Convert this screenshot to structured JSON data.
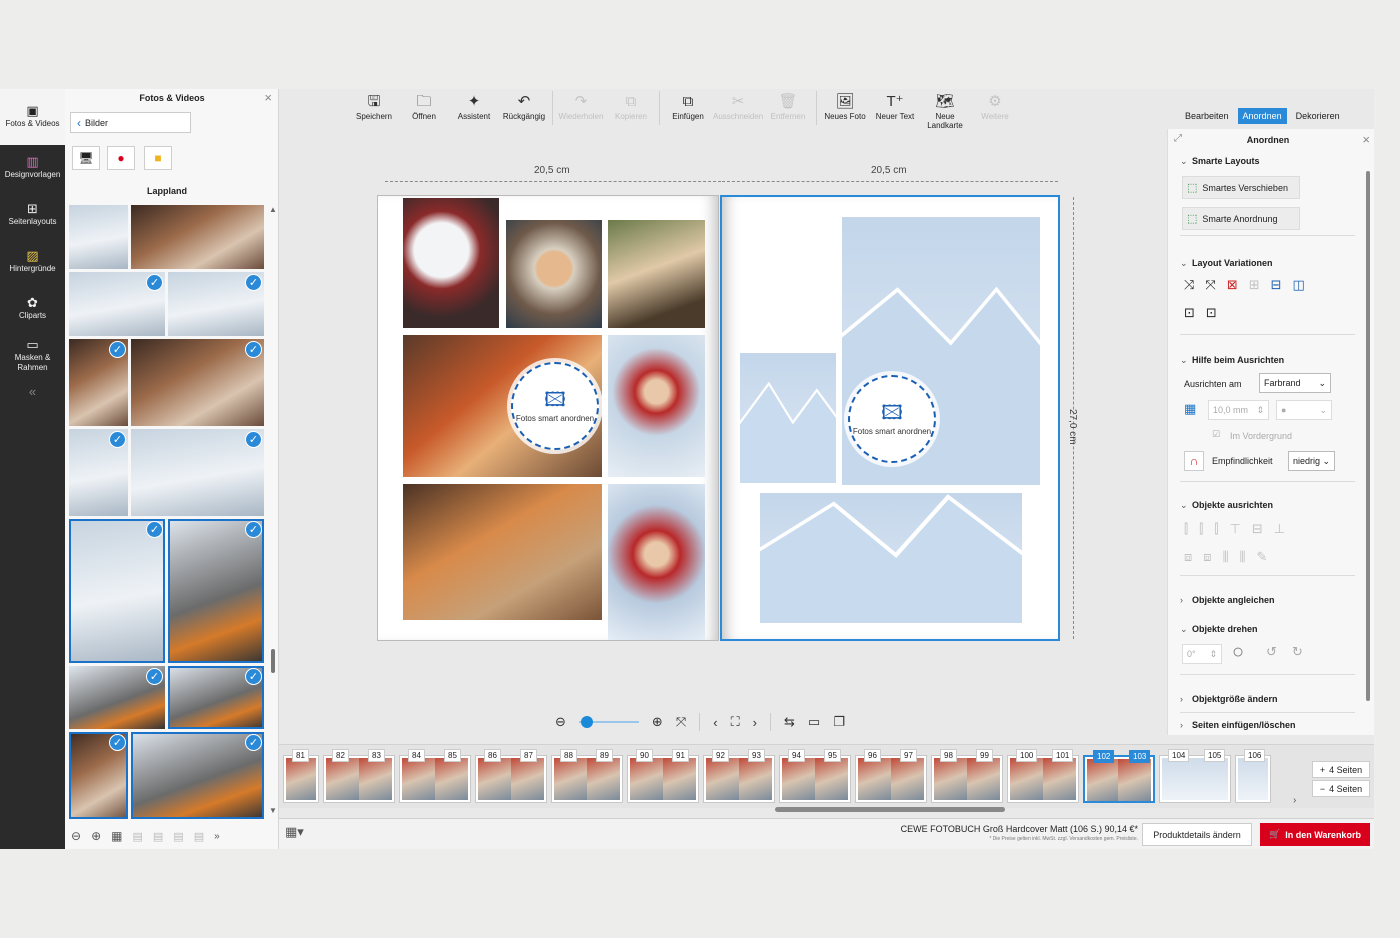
{
  "rail": {
    "items": [
      {
        "label": "Fotos & Videos",
        "icon": "photos-icon"
      },
      {
        "label": "Designvorlagen",
        "icon": "design-icon"
      },
      {
        "label": "Seitenlayouts",
        "icon": "layout-icon"
      },
      {
        "label": "Hintergründe",
        "icon": "background-icon"
      },
      {
        "label": "Cliparts",
        "icon": "clipart-icon"
      },
      {
        "label": "Masken & Rahmen",
        "icon": "mask-icon"
      }
    ],
    "collapse": "«"
  },
  "panel": {
    "title": "Fotos & Videos",
    "close": "×",
    "back_label": "Bilder",
    "album_title": "Lappland"
  },
  "toolbar": [
    {
      "label": "Speichern",
      "icon": "save-icon",
      "glyph": "🖫",
      "enabled": true
    },
    {
      "label": "Öffnen",
      "icon": "folder-icon",
      "glyph": "🗀",
      "enabled": true
    },
    {
      "label": "Assistent",
      "icon": "wand-icon",
      "glyph": "✦",
      "enabled": true
    },
    {
      "label": "Rückgängig",
      "icon": "undo-icon",
      "glyph": "↶",
      "enabled": true
    },
    {
      "label": "Wiederholen",
      "icon": "redo-icon",
      "glyph": "↷",
      "enabled": false
    },
    {
      "label": "Kopieren",
      "icon": "copy-icon",
      "glyph": "⧉",
      "enabled": false
    },
    {
      "label": "Einfügen",
      "icon": "paste-icon",
      "glyph": "⧉",
      "enabled": true
    },
    {
      "label": "Ausschneiden",
      "icon": "scissors-icon",
      "glyph": "✂",
      "enabled": false
    },
    {
      "label": "Entfernen",
      "icon": "trash-icon",
      "glyph": "🗑",
      "enabled": false
    },
    {
      "label": "Neues Foto",
      "icon": "new-photo-icon",
      "glyph": "🖼",
      "enabled": true
    },
    {
      "label": "Neuer Text",
      "icon": "new-text-icon",
      "glyph": "T⁺",
      "enabled": true
    },
    {
      "label": "Neue Landkarte",
      "icon": "map-icon",
      "glyph": "🗺",
      "enabled": true
    },
    {
      "label": "Weitere",
      "icon": "more-icon",
      "glyph": "⚙",
      "enabled": false
    }
  ],
  "canvas": {
    "left_width": "20,5 cm",
    "right_width": "20,5 cm",
    "height": "27,0 cm",
    "smart_label": "Fotos smart anordnen"
  },
  "nav": {
    "zoom_level": 0.05
  },
  "strip": {
    "pages": [
      {
        "a": "81",
        "b": null,
        "sel": false,
        "light": false
      },
      {
        "a": "82",
        "b": "83",
        "sel": false,
        "light": false
      },
      {
        "a": "84",
        "b": "85",
        "sel": false,
        "light": false
      },
      {
        "a": "86",
        "b": "87",
        "sel": false,
        "light": false
      },
      {
        "a": "88",
        "b": "89",
        "sel": false,
        "light": false
      },
      {
        "a": "90",
        "b": "91",
        "sel": false,
        "light": false
      },
      {
        "a": "92",
        "b": "93",
        "sel": false,
        "light": false
      },
      {
        "a": "94",
        "b": "95",
        "sel": false,
        "light": false
      },
      {
        "a": "96",
        "b": "97",
        "sel": false,
        "light": false
      },
      {
        "a": "98",
        "b": "99",
        "sel": false,
        "light": false
      },
      {
        "a": "100",
        "b": "101",
        "sel": false,
        "light": false
      },
      {
        "a": "102",
        "b": "103",
        "sel": true,
        "light": false
      },
      {
        "a": "104",
        "b": "105",
        "sel": false,
        "light": true
      },
      {
        "a": "106",
        "b": null,
        "sel": false,
        "light": true
      }
    ],
    "add_pages": "4 Seiten",
    "remove_pages": "4 Seiten"
  },
  "footer": {
    "product_name": "CEWE FOTOBUCH Groß Hardcover Matt (106 S.) 90,14 €*",
    "price_note": "* Die Preise gelten inkl. MwSt. zzgl. Versandkosten gem. Preisliste.",
    "details_button": "Produktdetails ändern",
    "cart_button": "In den Warenkorb"
  },
  "right": {
    "tabs": [
      {
        "label": "Bearbeiten",
        "active": false
      },
      {
        "label": "Anordnen",
        "active": true
      },
      {
        "label": "Dekorieren",
        "active": false
      }
    ],
    "title": "Anordnen",
    "smart_layouts": "Smarte Layouts",
    "smart_move": "Smartes Verschieben",
    "smart_arrange": "Smarte Anordnung",
    "layout_variations": "Layout Variationen",
    "align_help": "Hilfe beim Ausrichten",
    "align_to_label": "Ausrichten am",
    "align_to_value": "Farbrand",
    "grid_value": "10,0 mm",
    "foreground": "Im Vordergrund",
    "sensitivity_label": "Empfindlichkeit",
    "sensitivity_value": "niedrig",
    "align_objects": "Objekte ausrichten",
    "match_objects": "Objekte angleichen",
    "rotate_objects": "Objekte drehen",
    "rotate_value": "0°",
    "resize_objects": "Objektgröße ändern",
    "pages_insert": "Seiten einfügen/löschen"
  },
  "colors": {
    "accent": "#2a8ad8",
    "cart": "#d9001b"
  }
}
